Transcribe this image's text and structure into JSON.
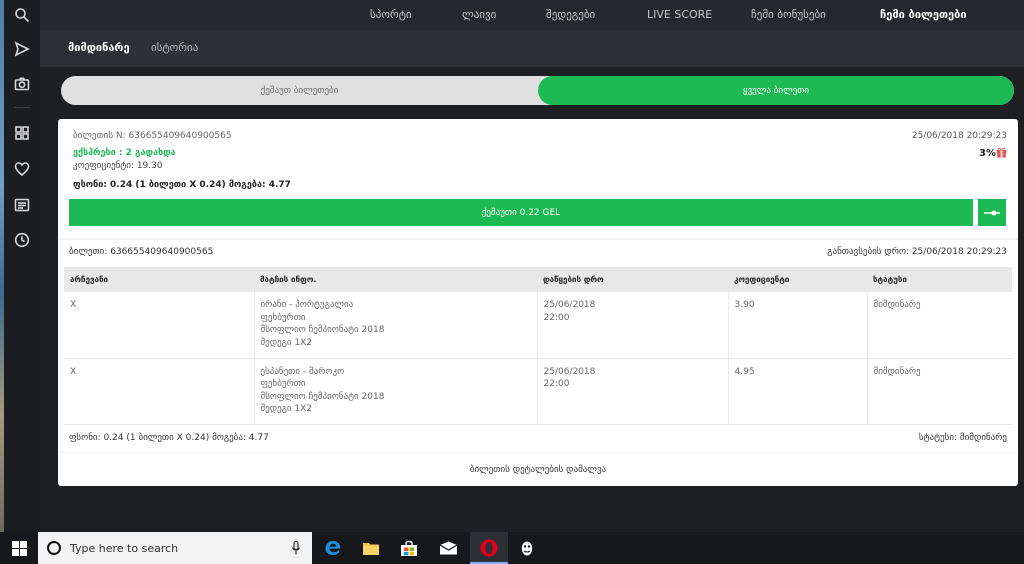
{
  "topnav": {
    "items": [
      "სპორტი",
      "ლაივი",
      "შედეგები",
      "LIVE SCORE",
      "ჩემი ბონუსები",
      "ჩემი ბილეთები"
    ],
    "active_index": 5
  },
  "subnav": {
    "items": [
      "მიმდინარე",
      "ისტორია"
    ],
    "active_index": 0
  },
  "toggle": {
    "left_label": "ქეშაუთ ბილეთები",
    "right_label": "ყველა ბილეთი"
  },
  "ticket": {
    "id_line": "ბილეთის N: 636655409640900565",
    "date": "25/06/2018 20:29:23",
    "express": "ექსპრესი : 2 გადახდა",
    "percent": "3%",
    "coef": "კოეფიციენტი: 19.30",
    "stake_line": "ფსონი: 0.24 (1 ბილეთი X 0.24)  მოგება: 4.77",
    "cashout_label": "ქეშაუთი 0.22 GEL",
    "ticket_no": "ბილეთი: 636655409640900565",
    "place_time": "განთავსების დრო: 25/06/2018 20:29:23",
    "table": {
      "headers": [
        "არჩევანი",
        "მატჩის ინფო.",
        "დაწყების დრო",
        "კოეფიციენტი",
        "სტატუსი"
      ],
      "rows": [
        {
          "choice": "X",
          "match": "ირანი - პორტუგალია",
          "sport": "ფეხბურთი",
          "league": "მსოფლიო ჩემპიონატი 2018",
          "market": "შედეგი 1X2",
          "date": "25/06/2018",
          "time": "22:00",
          "coef": "3.90",
          "status": "მიმდინარე"
        },
        {
          "choice": "X",
          "match": "ესპანეთი - მაროკო",
          "sport": "ფეხბურთი",
          "league": "მსოფლიო ჩემპიონატი 2018",
          "market": "შედეგი 1X2",
          "date": "25/06/2018",
          "time": "22:00",
          "coef": "4.95",
          "status": "მიმდინარე"
        }
      ]
    },
    "summary_left": "ფსონი: 0.24 (1 ბილეთი X 0.24)  მოგება: 4.77",
    "summary_right": "სტატუსი: მიმდინარე",
    "hide_details": "ბილეთის დეტალების დამალვა"
  },
  "taskbar": {
    "search_placeholder": "Type here to search"
  },
  "colors": {
    "accent_green": "#1db954",
    "nav_bg": "#26282d",
    "rail_bg": "#1b1d21"
  },
  "icons": [
    "search-icon",
    "send-icon",
    "camera-icon",
    "grid-icon",
    "heart-icon",
    "news-icon",
    "clock-icon",
    "gift-icon",
    "slider-icon",
    "windows-icon",
    "mic-icon",
    "edge-icon",
    "folder-icon",
    "store-icon",
    "mail-icon",
    "opera-icon",
    "app-icon"
  ]
}
